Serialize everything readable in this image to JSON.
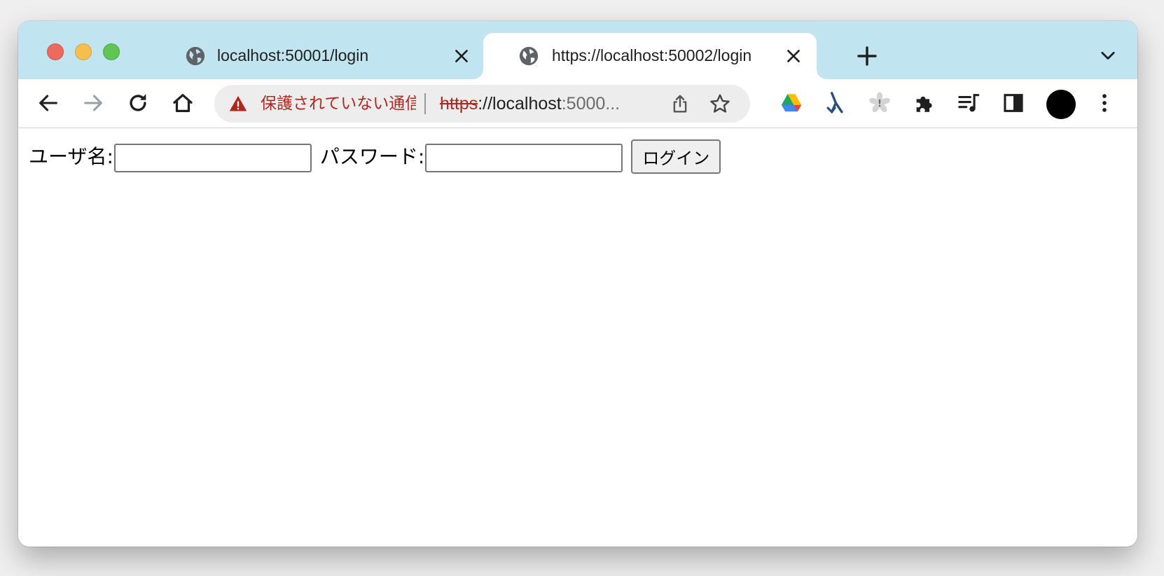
{
  "browser": {
    "tabs": [
      {
        "title": "localhost:50001/login",
        "active": false,
        "favicon": "globe-icon"
      },
      {
        "title": "https://localhost:50002/login",
        "active": true,
        "favicon": "globe-icon"
      }
    ],
    "omnibox": {
      "security_warning": "保護されていない通信",
      "url_scheme": "https",
      "url_rest": "://localhost",
      "url_port": ":5000..."
    },
    "extension_icons": [
      "google-drive-icon",
      "branch-arrows-icon",
      "sakura-icon",
      "puzzle-extensions-icon",
      "reading-list-icon",
      "side-panel-icon"
    ],
    "colors": {
      "tabstrip": "#c1e5f0",
      "warning_red": "#b3261e",
      "avatar": "#000000"
    }
  },
  "page": {
    "username_label": "ユーザ名:",
    "username_value": "",
    "password_label": "パスワード:",
    "password_value": "",
    "login_button": "ログイン"
  }
}
